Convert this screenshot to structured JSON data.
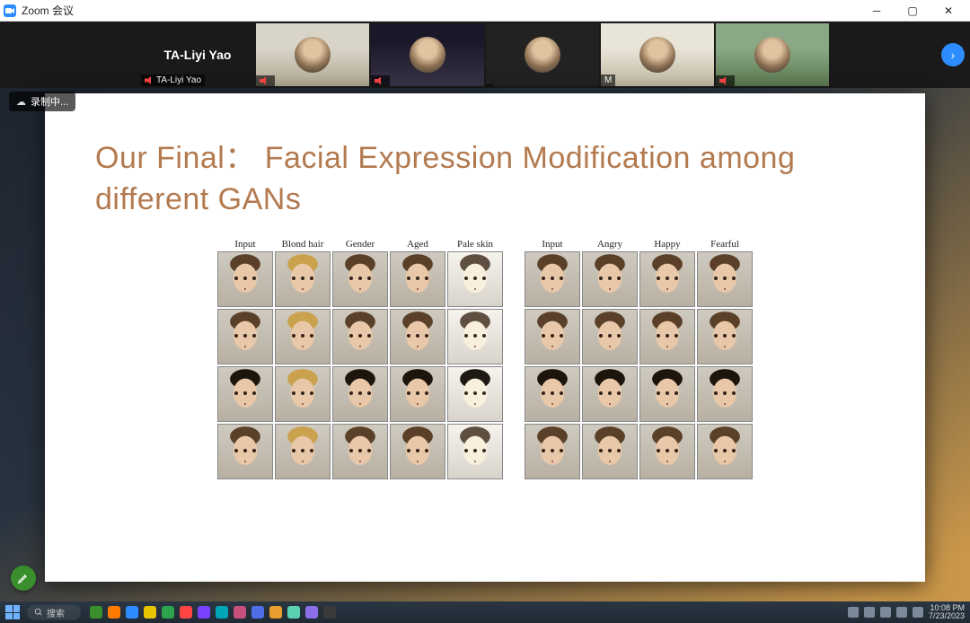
{
  "window": {
    "title": "Zoom 会议"
  },
  "gallery": {
    "self_tile_name": "TA-Liyi Yao",
    "self_label": "TA-Liyi Yao",
    "tiles": [
      {
        "name": ""
      },
      {
        "name": ""
      },
      {
        "name": ""
      },
      {
        "name": "M"
      },
      {
        "name": ""
      }
    ]
  },
  "recording": {
    "label": "录制中..."
  },
  "slide": {
    "title": "Our Final： Facial Expression Modification among different GANs",
    "left_grid_headers": [
      "Input",
      "Blond hair",
      "Gender",
      "Aged",
      "Pale skin"
    ],
    "right_grid_headers": [
      "Input",
      "Angry",
      "Happy",
      "Fearful"
    ],
    "rows": 4
  },
  "taskbar": {
    "search_placeholder": "搜索",
    "clock_time": "10:08 PM",
    "clock_date": "7/23/2023",
    "app_colors": [
      "#3a8f2d",
      "#ff7a00",
      "#2d8cff",
      "#e8c400",
      "#2da44e",
      "#ff4444",
      "#7a42ff",
      "#00a5b8",
      "#c94f7c",
      "#4f6fe8",
      "#e89f2d",
      "#5ad1b0",
      "#8a6fe8",
      "#3a3a3a"
    ]
  }
}
